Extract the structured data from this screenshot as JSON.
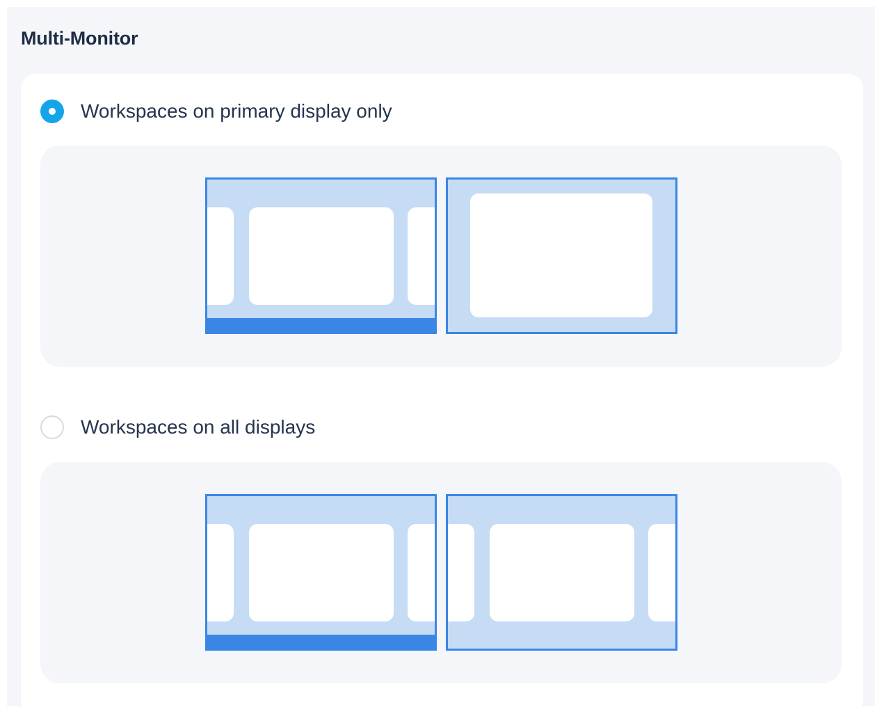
{
  "section": {
    "title": "Multi-Monitor"
  },
  "options": [
    {
      "label": "Workspaces on primary display only",
      "selected": true,
      "preview_icon": "primary-display-workspaces-diagram"
    },
    {
      "label": "Workspaces on all displays",
      "selected": false,
      "preview_icon": "all-displays-workspaces-diagram"
    }
  ],
  "colors": {
    "accent": "#14a4ea",
    "monitor_border": "#3a86e6",
    "monitor_fill": "#c6dcf5",
    "text": "#26344d",
    "panel_bg": "#f5f6f9"
  }
}
